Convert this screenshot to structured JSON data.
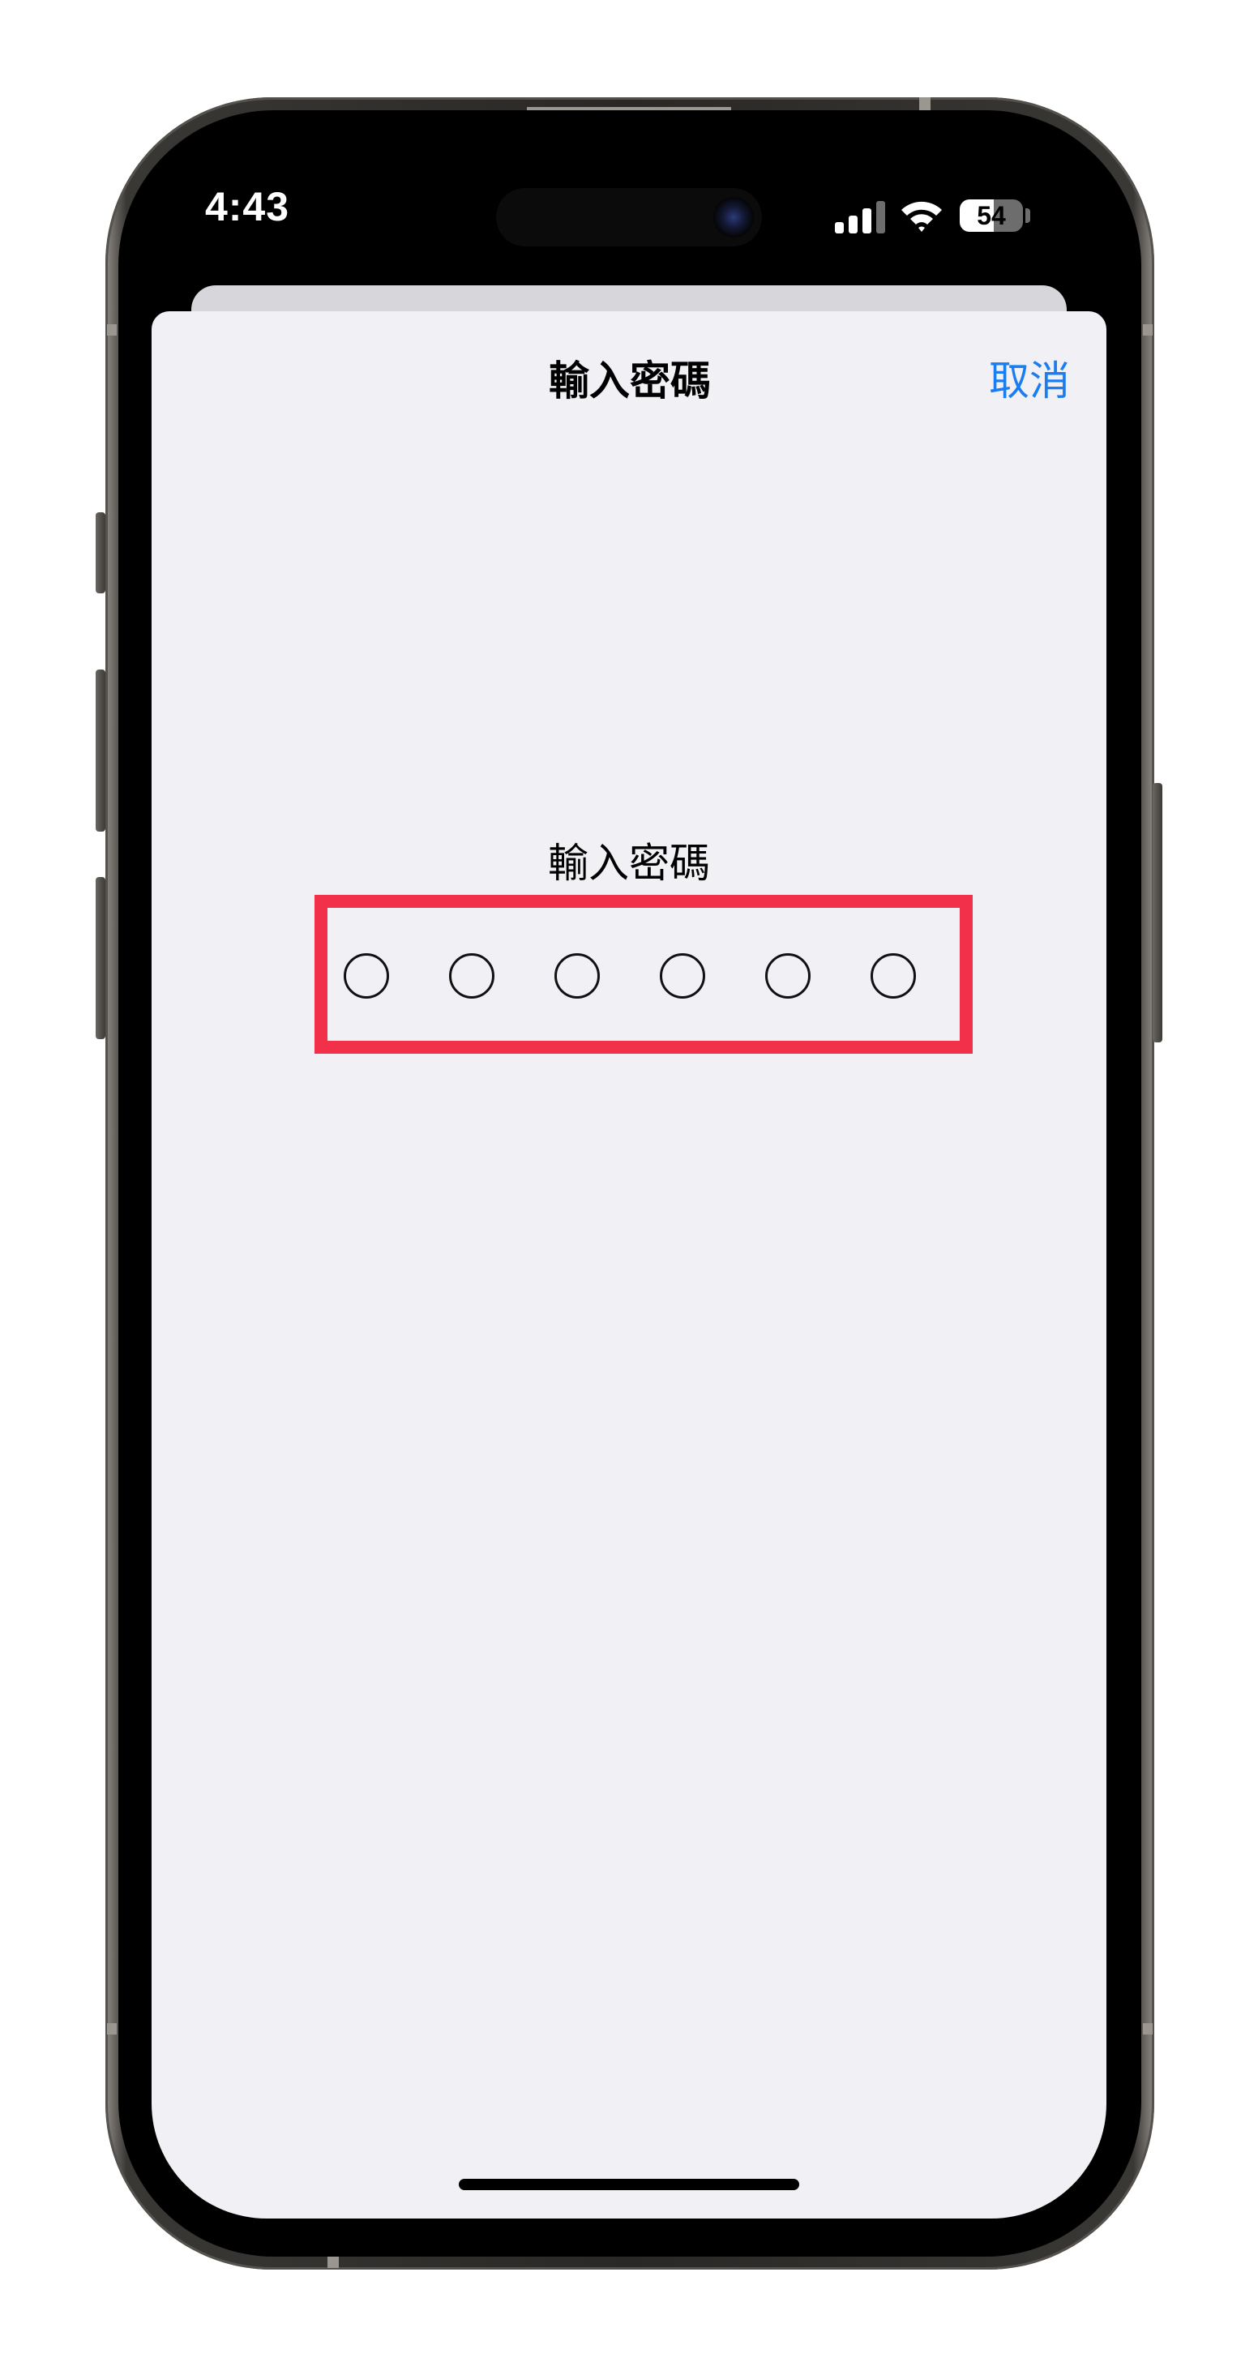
{
  "status_bar": {
    "time": "4:43",
    "battery_level": "54",
    "battery_fraction": 0.54,
    "icons": [
      "cellular-signal-icon",
      "wifi-icon",
      "battery-icon"
    ]
  },
  "nav": {
    "title": "輸入密碼",
    "cancel_label": "取消"
  },
  "passcode": {
    "prompt": "輸入密碼",
    "digit_count": 6,
    "entered": 0
  },
  "colors": {
    "accent": "#1a7df0",
    "highlight": "#f23049",
    "sheet_background": "#f0f0f5"
  }
}
